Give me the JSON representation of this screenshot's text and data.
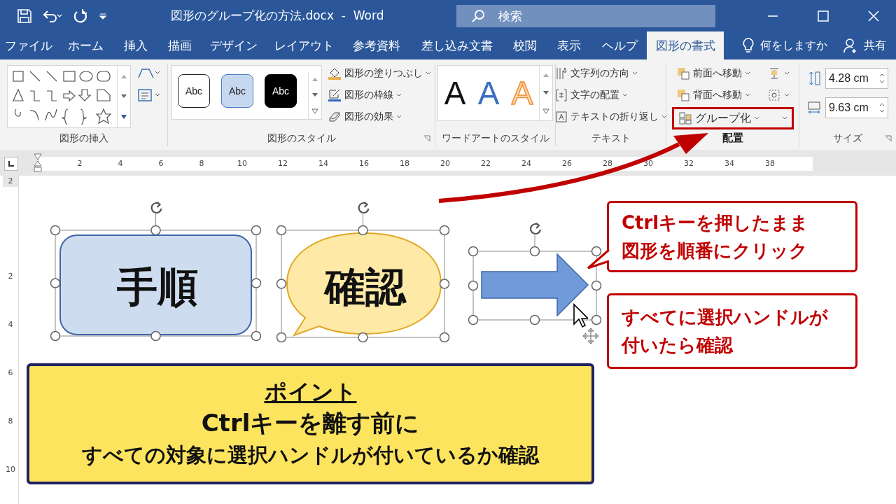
{
  "title_bar": {
    "title": "図形のグループ化の方法.docx  -  Word",
    "search": {
      "placeholder": "検索"
    }
  },
  "ribbon_tabs": [
    {
      "label": "ファイル",
      "selected": false
    },
    {
      "label": "ホーム",
      "selected": false
    },
    {
      "label": "挿入",
      "selected": false
    },
    {
      "label": "描画",
      "selected": false
    },
    {
      "label": "デザイン",
      "selected": false
    },
    {
      "label": "レイアウト",
      "selected": false
    },
    {
      "label": "参考資料",
      "selected": false
    },
    {
      "label": "差し込み文書",
      "selected": false
    },
    {
      "label": "校閲",
      "selected": false
    },
    {
      "label": "表示",
      "selected": false
    },
    {
      "label": "ヘルプ",
      "selected": false
    },
    {
      "label": "図形の書式",
      "selected": true
    }
  ],
  "tell_me": "何をしますか",
  "share": "共有",
  "ribbon": {
    "insert_shapes": {
      "label": "図形の挿入"
    },
    "shape_styles": {
      "label": "図形のスタイル",
      "presets": [
        {
          "kind": "outline",
          "text": "Abc"
        },
        {
          "kind": "light",
          "text": "Abc"
        },
        {
          "kind": "dark",
          "text": "Abc"
        }
      ],
      "commands": [
        {
          "kind": "fill",
          "label": "図形の塗りつぶし"
        },
        {
          "kind": "outline",
          "label": "図形の枠線"
        },
        {
          "kind": "effects",
          "label": "図形の効果"
        }
      ]
    },
    "wordart": {
      "label": "ワードアートのスタイル",
      "presets": [
        {
          "kind": "dark",
          "text": "A"
        },
        {
          "kind": "blue",
          "text": "A"
        },
        {
          "kind": "orange-outline",
          "text": "A"
        }
      ]
    },
    "text": {
      "label": "テキスト",
      "commands": [
        {
          "kind": "direction",
          "label": "文字列の方向"
        },
        {
          "kind": "align",
          "label": "文字の配置"
        },
        {
          "kind": "wrap",
          "label": "テキストの折り返し"
        }
      ]
    },
    "arrange": {
      "label": "配置",
      "commands": [
        {
          "kind": "forward",
          "label": "前面へ移動",
          "highlighted": false
        },
        {
          "kind": "backward",
          "label": "背面へ移動",
          "highlighted": false
        },
        {
          "kind": "group",
          "label": "グループ化",
          "highlighted": true
        }
      ]
    },
    "size": {
      "label": "サイズ",
      "height": "4.28 cm",
      "width": "9.63 cm"
    }
  },
  "ruler": {
    "numbers": [
      "2",
      "4",
      "6",
      "8",
      "10",
      "12",
      "14",
      "16",
      "18",
      "20",
      "22",
      "24",
      "26",
      "28",
      "30",
      "32",
      "34",
      "38"
    ]
  },
  "vertical_ruler": {
    "numbers": [
      "2",
      "2",
      "4",
      "6",
      "8",
      "10"
    ]
  },
  "shapes": [
    {
      "kind": "rounded-rect",
      "text": "手順",
      "selected": true
    },
    {
      "kind": "speech-bubble",
      "text": "確認",
      "selected": true
    },
    {
      "kind": "arrow",
      "selected": true
    }
  ],
  "callouts": [
    {
      "lines": [
        "Ctrlキーを押したまま",
        "図形を順番にクリック"
      ]
    },
    {
      "lines": [
        "すべてに選択ハンドルが",
        "付いたら確認"
      ]
    }
  ],
  "point": {
    "title": "ポイント",
    "lines": [
      "Ctrlキーを離す前に",
      "すべての対象に選択ハンドルが付いているか確認"
    ]
  }
}
